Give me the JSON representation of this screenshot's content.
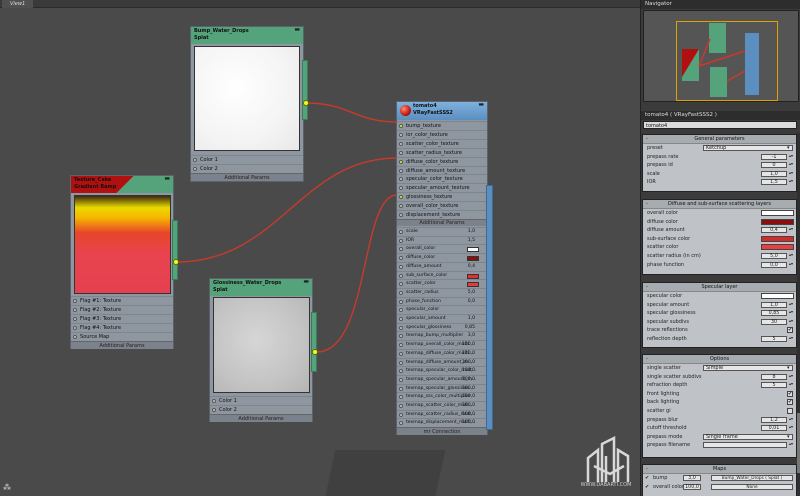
{
  "view": {
    "tab_label": "View1"
  },
  "nodes": {
    "bump": {
      "title": "Bump_Water_Drops",
      "subtitle": "Splat",
      "ports": [
        "Color 1",
        "Color 2"
      ],
      "additional": "Additional Params"
    },
    "texture": {
      "title": "Texture_Cake",
      "subtitle": "Gradient Ramp",
      "ports": [
        "Flag #1: Texture",
        "Flag #2: Texture",
        "Flag #3: Texture",
        "Flag #4: Texture",
        "Source Map"
      ],
      "additional": "Additional Params"
    },
    "gloss": {
      "title": "Glossiness_Water_Drops",
      "subtitle": "Splat",
      "ports": [
        "Color 1",
        "Color 2"
      ],
      "additional": "Additional Params"
    },
    "material": {
      "title": "tomato4",
      "subtitle": "VRayFastSSS2",
      "texture_ports": [
        "bump_texture",
        "ior_color_texture",
        "scatter_color_texture",
        "scatter_radius_texture",
        "diffuse_color_texture",
        "diffuse_amount_texture",
        "specular_color_texture",
        "specular_amount_texture",
        "glossiness_texture",
        "overall_color_texture",
        "displacement_texture"
      ],
      "additional": "Additional Params",
      "params": [
        {
          "label": "scale",
          "value": "1,0"
        },
        {
          "label": "IOR",
          "value": "1,5"
        },
        {
          "label": "overall_color",
          "value": "",
          "swatch": "#ffffff"
        },
        {
          "label": "diffuse_color",
          "value": "",
          "swatch": "#8a0f0f"
        },
        {
          "label": "diffuse_amount",
          "value": "0,4"
        },
        {
          "label": "sub_surface_color",
          "value": "",
          "swatch": "#e23030"
        },
        {
          "label": "scatter_color",
          "value": "",
          "swatch": "#e83a3a"
        },
        {
          "label": "scatter_radius",
          "value": "5,0"
        },
        {
          "label": "phase_function",
          "value": "0,0"
        },
        {
          "label": "specular_color",
          "value": ""
        },
        {
          "label": "specular_amount",
          "value": "1,0"
        },
        {
          "label": "specular_glossiness",
          "value": "0,85"
        },
        {
          "label": "texmap_bump_multiplier",
          "value": "3,0"
        },
        {
          "label": "texmap_overall_color_multi...",
          "value": "100,0"
        },
        {
          "label": "texmap_diffuse_color_multi...",
          "value": "100,0"
        },
        {
          "label": "texmap_diffuse_amount_m...",
          "value": "100,0"
        },
        {
          "label": "texmap_specular_color_mult...",
          "value": "100,0"
        },
        {
          "label": "texmap_specular_amount_m...",
          "value": "100,0"
        },
        {
          "label": "texmap_specular_glossines...",
          "value": "100,0"
        },
        {
          "label": "texmap_sss_color_multiplier",
          "value": "100,0"
        },
        {
          "label": "texmap_scatter_color_mult...",
          "value": "100,0"
        },
        {
          "label": "texmap_scatter_radius_mult...",
          "value": "100,0"
        },
        {
          "label": "texmap_displacement_multi...",
          "value": "100,0"
        }
      ],
      "footer": "mr Connection"
    }
  },
  "navigator": {
    "title": "Navigator"
  },
  "properties": {
    "header": "tomato4  ( VRayFastSSS2 )",
    "name_field": "tomato4",
    "general": {
      "title": "General parameters",
      "rows": [
        {
          "label": "preset",
          "dropdown": "Ketchup"
        },
        {
          "label": "prepass rate",
          "value": "-1"
        },
        {
          "label": "prepass id",
          "value": "0"
        },
        {
          "label": "scale",
          "value": "1,0"
        },
        {
          "label": "IOR",
          "value": "1,5"
        }
      ]
    },
    "diffuse": {
      "title": "Diffuse and sub-surface scattering layers",
      "rows": [
        {
          "label": "overall color",
          "swatch": "#ffffff"
        },
        {
          "label": "diffuse color",
          "swatch": "#8a0f0f"
        },
        {
          "label": "diffuse amount",
          "value": "0,4"
        },
        {
          "label": "sub-surface color",
          "swatch": "#d42a2a"
        },
        {
          "label": "scatter color",
          "swatch": "#e84040"
        },
        {
          "label": "scatter radius (in cm)",
          "value": "5,0"
        },
        {
          "label": "phase function",
          "value": "0,0"
        }
      ]
    },
    "specular": {
      "title": "Specular layer",
      "rows": [
        {
          "label": "specular color",
          "swatch": "#ffffff"
        },
        {
          "label": "specular amount",
          "value": "1,0"
        },
        {
          "label": "specular glossiness",
          "value": "0,85"
        },
        {
          "label": "specular subdivs",
          "value": "30"
        },
        {
          "label": "trace reflections",
          "check": "✔"
        },
        {
          "label": "reflection depth",
          "value": "5"
        }
      ]
    },
    "options": {
      "title": "Options",
      "rows": [
        {
          "label": "single scatter",
          "dropdown": "Simple"
        },
        {
          "label": "single scatter subdivs",
          "value": "8"
        },
        {
          "label": "refraction depth",
          "value": "5"
        },
        {
          "label": "front lighting",
          "check": "✔"
        },
        {
          "label": "back lighting",
          "check": "✔"
        },
        {
          "label": "scatter gi",
          "check": ""
        },
        {
          "label": "prepass blur",
          "value": "1,2"
        },
        {
          "label": "cutoff threshold",
          "value": "0,01"
        },
        {
          "label": "prepass mode",
          "dropdown": "Single frame"
        },
        {
          "label": "prepass filename",
          "value": ""
        }
      ]
    },
    "maps": {
      "title": "Maps",
      "rows": [
        {
          "label": "bump",
          "amount": "3,0",
          "map": "Bump_Water_Drops  ( Splat )"
        },
        {
          "label": "overall color",
          "amount": "100,0",
          "map": "None"
        }
      ]
    }
  },
  "watermark": {
    "site": "WWW.DABARTI.COM"
  },
  "colors": {
    "node_green": "#55a37a",
    "material_blue": "#5b8fc0",
    "wire_red": "#c83a2a",
    "port_yellow": "#e9ff2a"
  }
}
